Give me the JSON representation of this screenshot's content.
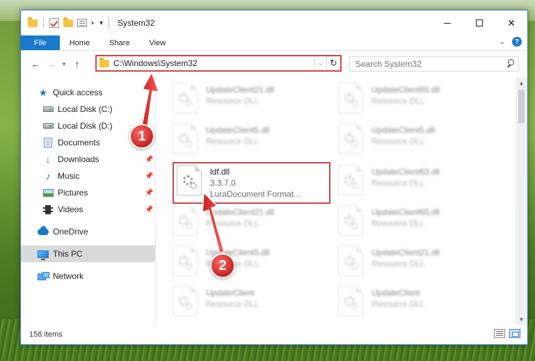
{
  "window": {
    "title": "System32"
  },
  "ribbon": {
    "tabs": [
      {
        "label": "File"
      },
      {
        "label": "Home"
      },
      {
        "label": "Share"
      },
      {
        "label": "View"
      }
    ],
    "help": "?"
  },
  "address": {
    "path": "C:\\Windows\\System32"
  },
  "search": {
    "placeholder": "Search System32"
  },
  "sidebar": {
    "items": [
      {
        "label": "Quick access",
        "icon": "star-icon"
      },
      {
        "label": "Local Disk (C:)",
        "icon": "drive-icon"
      },
      {
        "label": "Local Disk (D:)",
        "icon": "drive-icon"
      },
      {
        "label": "Documents",
        "icon": "documents-icon",
        "pinned": true
      },
      {
        "label": "Downloads",
        "icon": "download-icon",
        "pinned": true
      },
      {
        "label": "Music",
        "icon": "music-icon",
        "pinned": true
      },
      {
        "label": "Pictures",
        "icon": "pictures-icon",
        "pinned": true
      },
      {
        "label": "Videos",
        "icon": "videos-icon",
        "pinned": true
      },
      {
        "label": "OneDrive",
        "icon": "cloud-icon"
      },
      {
        "label": "This PC",
        "icon": "pc-icon",
        "selected": true
      },
      {
        "label": "Network",
        "icon": "network-icon"
      }
    ]
  },
  "files": {
    "highlighted": {
      "name": "ldf.dll",
      "version": "3.3.7.0",
      "description": "LuraDocument Format..."
    },
    "blurred": [
      {
        "name": "UpdateClient21.dll",
        "description": "Resource DLL"
      },
      {
        "name": "UpdateClient65.dll",
        "description": "Resource DLL"
      },
      {
        "name": "UpdateClient5.dll",
        "description": "Resource DLL"
      },
      {
        "name": "UpdateClient5.dll",
        "description": "Resource DLL"
      },
      {
        "name": "UpdateClient63.dll",
        "description": "Resource DLL"
      },
      {
        "name": "UpdateClient65.dll",
        "description": "Resource DLL"
      },
      {
        "name": "UpdateClient21.dll",
        "description": "Resource DLL"
      },
      {
        "name": "UpdateClient5.dll",
        "description": "Resource DLL"
      },
      {
        "name": "UpdateClient21.dll",
        "description": "Resource DLL"
      },
      {
        "name": "UpdateClient",
        "description": "Resource DLL"
      },
      {
        "name": "UpdateClient",
        "description": "Resource DLL"
      }
    ]
  },
  "status": {
    "item_count": "158 items"
  },
  "annotations": {
    "badge1": "1",
    "badge2": "2",
    "color": "#d04545"
  }
}
